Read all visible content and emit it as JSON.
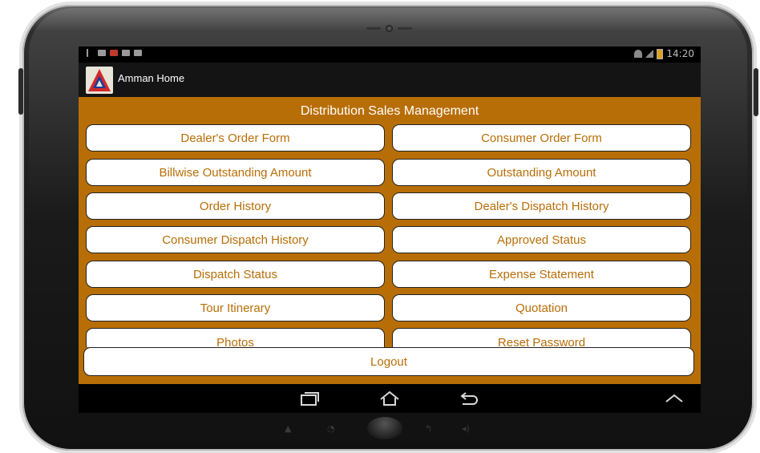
{
  "status_bar": {
    "time": "14:20"
  },
  "app": {
    "title": "Amman Home",
    "logo_icon": "amman-logo-icon"
  },
  "main": {
    "heading": "Distribution Sales Management",
    "menu": [
      {
        "label": "Dealer's Order Form"
      },
      {
        "label": "Consumer Order Form"
      },
      {
        "label": "Billwise Outstanding Amount"
      },
      {
        "label": "Outstanding Amount"
      },
      {
        "label": "Order History"
      },
      {
        "label": "Dealer's Dispatch History"
      },
      {
        "label": "Consumer Dispatch History"
      },
      {
        "label": "Approved Status"
      },
      {
        "label": "Dispatch Status"
      },
      {
        "label": "Expense Statement"
      },
      {
        "label": "Tour Itinerary"
      },
      {
        "label": "Quotation"
      },
      {
        "label": "Photos"
      },
      {
        "label": "Reset Password"
      }
    ],
    "logout_label": "Logout"
  },
  "nav_bar": {
    "icons": [
      "recent-apps-icon",
      "home-icon",
      "back-icon",
      "chevron-up-icon"
    ]
  },
  "colors": {
    "accent": "#b86e07",
    "button_bg": "#ffffff",
    "action_bar": "#141414"
  }
}
